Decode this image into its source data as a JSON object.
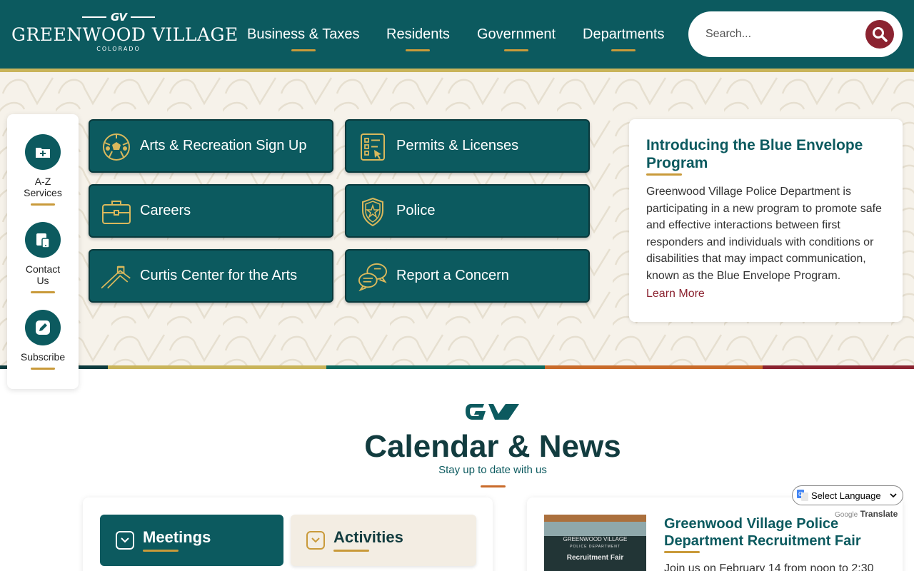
{
  "header": {
    "logo": {
      "mark": "GV",
      "name": "GREENWOOD VILLAGE",
      "sub": "COLORADO"
    },
    "nav": [
      {
        "label": "Business & Taxes"
      },
      {
        "label": "Residents"
      },
      {
        "label": "Government"
      },
      {
        "label": "Departments"
      }
    ],
    "search": {
      "placeholder": "Search..."
    }
  },
  "quick_links": [
    {
      "label": "A-Z Services",
      "icon": "folder-plus-icon"
    },
    {
      "label": "Contact Us",
      "icon": "devices-icon"
    },
    {
      "label": "Subscribe",
      "icon": "pencil-icon"
    }
  ],
  "tiles": [
    {
      "label": "Arts & Recreation Sign Up",
      "icon": "soccer-ball-icon"
    },
    {
      "label": "Permits & Licenses",
      "icon": "checklist-icon"
    },
    {
      "label": "Careers",
      "icon": "briefcase-icon"
    },
    {
      "label": "Police",
      "icon": "police-badge-icon"
    },
    {
      "label": "Curtis Center for the Arts",
      "icon": "building-icon"
    },
    {
      "label": "Report a Concern",
      "icon": "chat-bubbles-icon"
    }
  ],
  "feature": {
    "title": "Introducing the Blue Envelope Program",
    "text": "Greenwood Village Police Department is participating in a new program to promote safe and effective interactions between first responders and individuals with conditions or disabilities that may impact communication, known as the Blue Envelope Program.",
    "link": "Learn More"
  },
  "calendar_news": {
    "mark": "GV",
    "title": "Calendar & News",
    "subtitle": "Stay up to date with us",
    "tabs": [
      {
        "label": "Meetings"
      },
      {
        "label": "Activities"
      }
    ],
    "news": {
      "title": "Greenwood Village Police Department Recruitment Fair",
      "text": "Join us on February 14 from noon to 2:30",
      "image_sign": {
        "org": "GREENWOOD VILLAGE",
        "dept": "POLICE DEPARTMENT",
        "caption": "Recruitment Fair"
      }
    }
  },
  "translate": {
    "label": "Select Language",
    "powered_by": "Google",
    "translate_label": "Translate"
  },
  "colors": {
    "primary": "#0c5a5f",
    "accent_gold": "#c99a3a",
    "accent_maroon": "#8b2330",
    "hero_bg": "#f6f2ea",
    "band": [
      "#0c3b3e",
      "#c9b45a",
      "#0c6a5f",
      "#c96b2a",
      "#8b2330"
    ]
  }
}
